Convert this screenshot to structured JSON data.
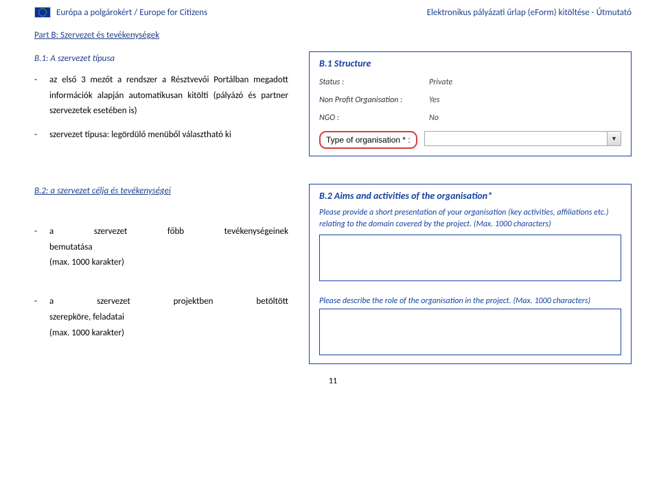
{
  "header": {
    "left": "Európa a polgárokért / Europe for Citizens",
    "right": "Elektronikus pályázati űrlap (eForm) kitöltése - Útmutató"
  },
  "partB": {
    "title": "Part B: Szervezet és tevékenységek",
    "b1": {
      "title": "B.1: A szervezet típusa",
      "bullet1": "az első 3 mezőt a rendszer a Résztvevői Portálban megadott információk alapján automatikusan kitölti (pályázó és partner szervezetek esetében is)",
      "bullet2": "szervezet típusa: legördülő menüből választható ki"
    },
    "b2": {
      "title": "B.2: a szervezet célja és tevékenységei",
      "bullet1words": [
        "a",
        "szervezet",
        "főbb",
        "tevékenységeinek"
      ],
      "bullet1line2": "bemutatása",
      "bullet1line3": "(max. 1000 karakter)",
      "bullet2words": [
        "a",
        "szervezet",
        "projektben",
        "betöltött"
      ],
      "bullet2line2": "szerepköre, feladatai",
      "bullet2line3": "(max. 1000 karakter)"
    }
  },
  "panel1": {
    "title": "B.1 Structure",
    "rows": [
      {
        "label": "Status :",
        "value": "Private"
      },
      {
        "label": "Non Profit Organisation :",
        "value": "Yes"
      },
      {
        "label": "NGO :",
        "value": "No"
      }
    ],
    "type_label": "Type of organisation * :"
  },
  "panel2": {
    "title": "B.2 Aims and activities of the organisation*",
    "desc1": "Please provide a short presentation of your organisation (key activities, affiliations etc.) relating to the domain covered by the project. (Max. 1000 characters)",
    "desc2": "Please describe the role of the organisation in the project. (Max. 1000 characters)"
  },
  "page_number": "11"
}
